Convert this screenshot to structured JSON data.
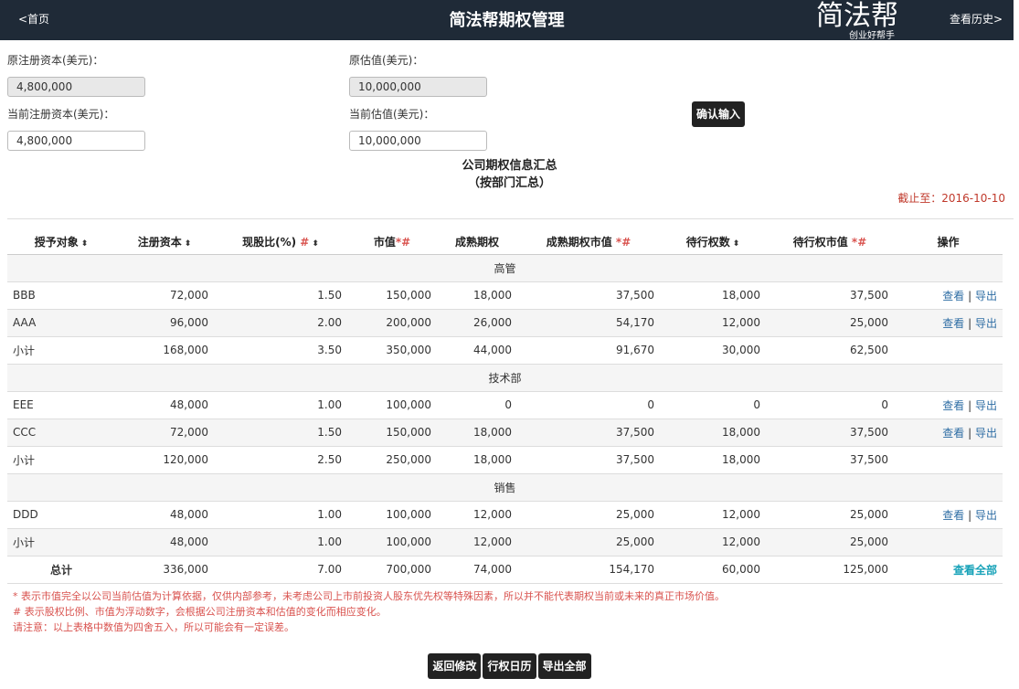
{
  "header": {
    "back_label": "<首页",
    "title": "简法帮期权管理",
    "logo_big": "简法帮",
    "logo_small": "创业好帮手",
    "history_label": "查看历史>"
  },
  "form": {
    "orig_capital_label": "原注册资本(美元)：",
    "orig_capital_value": "4,800,000",
    "orig_valuation_label": "原估值(美元)：",
    "orig_valuation_value": "10,000,000",
    "cur_capital_label": "当前注册资本(美元)：",
    "cur_capital_value": "4,800,000",
    "cur_valuation_label": "当前估值(美元)：",
    "cur_valuation_value": "10,000,000",
    "confirm_label": "确认输入"
  },
  "summary": {
    "title": "公司期权信息汇总",
    "subtitle": "（按部门汇总）",
    "as_of": "截止至：2016-10-10"
  },
  "table": {
    "headers": {
      "grantee": "授予对象",
      "capital": "注册资本",
      "ratio": "现股比(%)",
      "ratio_mark": "#",
      "market_value": "市值",
      "market_value_mark": "*#",
      "mature": "成熟期权",
      "mature_value": "成熟期权市值",
      "mature_value_mark": "*#",
      "pending": "待行权数",
      "pending_value": "待行权市值",
      "pending_value_mark": "*#",
      "ops": "操作",
      "sort_icon": "⬍"
    },
    "groups": [
      {
        "dept": "高管",
        "rows": [
          {
            "name": "BBB",
            "capital": "72,000",
            "ratio": "1.50",
            "mv": "150,000",
            "mature": "18,000",
            "mature_mv": "37,500",
            "pending": "18,000",
            "pending_mv": "37,500",
            "view": "查看",
            "sep": "|",
            "export": "导出"
          },
          {
            "name": "AAA",
            "capital": "96,000",
            "ratio": "2.00",
            "mv": "200,000",
            "mature": "26,000",
            "mature_mv": "54,170",
            "pending": "12,000",
            "pending_mv": "25,000",
            "view": "查看",
            "sep": "|",
            "export": "导出"
          }
        ],
        "subtotal": {
          "name": "小计",
          "capital": "168,000",
          "ratio": "3.50",
          "mv": "350,000",
          "mature": "44,000",
          "mature_mv": "91,670",
          "pending": "30,000",
          "pending_mv": "62,500"
        }
      },
      {
        "dept": "技术部",
        "rows": [
          {
            "name": "EEE",
            "capital": "48,000",
            "ratio": "1.00",
            "mv": "100,000",
            "mature": "0",
            "mature_mv": "0",
            "pending": "0",
            "pending_mv": "0",
            "view": "查看",
            "sep": "|",
            "export": "导出"
          },
          {
            "name": "CCC",
            "capital": "72,000",
            "ratio": "1.50",
            "mv": "150,000",
            "mature": "18,000",
            "mature_mv": "37,500",
            "pending": "18,000",
            "pending_mv": "37,500",
            "view": "查看",
            "sep": "|",
            "export": "导出"
          }
        ],
        "subtotal": {
          "name": "小计",
          "capital": "120,000",
          "ratio": "2.50",
          "mv": "250,000",
          "mature": "18,000",
          "mature_mv": "37,500",
          "pending": "18,000",
          "pending_mv": "37,500"
        }
      },
      {
        "dept": "销售",
        "rows": [
          {
            "name": "DDD",
            "capital": "48,000",
            "ratio": "1.00",
            "mv": "100,000",
            "mature": "12,000",
            "mature_mv": "25,000",
            "pending": "12,000",
            "pending_mv": "25,000",
            "view": "查看",
            "sep": "|",
            "export": "导出"
          }
        ],
        "subtotal": {
          "name": "小计",
          "capital": "48,000",
          "ratio": "1.00",
          "mv": "100,000",
          "mature": "12,000",
          "mature_mv": "25,000",
          "pending": "12,000",
          "pending_mv": "25,000"
        }
      }
    ],
    "total": {
      "name": "总计",
      "capital": "336,000",
      "ratio": "7.00",
      "mv": "700,000",
      "mature": "74,000",
      "mature_mv": "154,170",
      "pending": "60,000",
      "pending_mv": "125,000",
      "view_all": "查看全部"
    }
  },
  "notes": [
    "* 表示市值完全以公司当前估值为计算依据，仅供内部参考，未考虑公司上市前投资人股东优先权等特殊因素，所以并不能代表期权当前或未来的真正市场价值。",
    "# 表示股权比例、市值为浮动数字，会根据公司注册资本和估值的变化而相应变化。",
    "请注意：以上表格中数值为四舍五入，所以可能会有一定误差。"
  ],
  "footer_buttons": {
    "back_edit": "返回修改",
    "exercise_calendar": "行权日历",
    "export_all": "导出全部"
  },
  "colors": {
    "header_bg": "#1f2a37",
    "note_red": "#d9534f",
    "link_blue": "#2e6da4",
    "view_all_teal": "#17a2b8"
  }
}
